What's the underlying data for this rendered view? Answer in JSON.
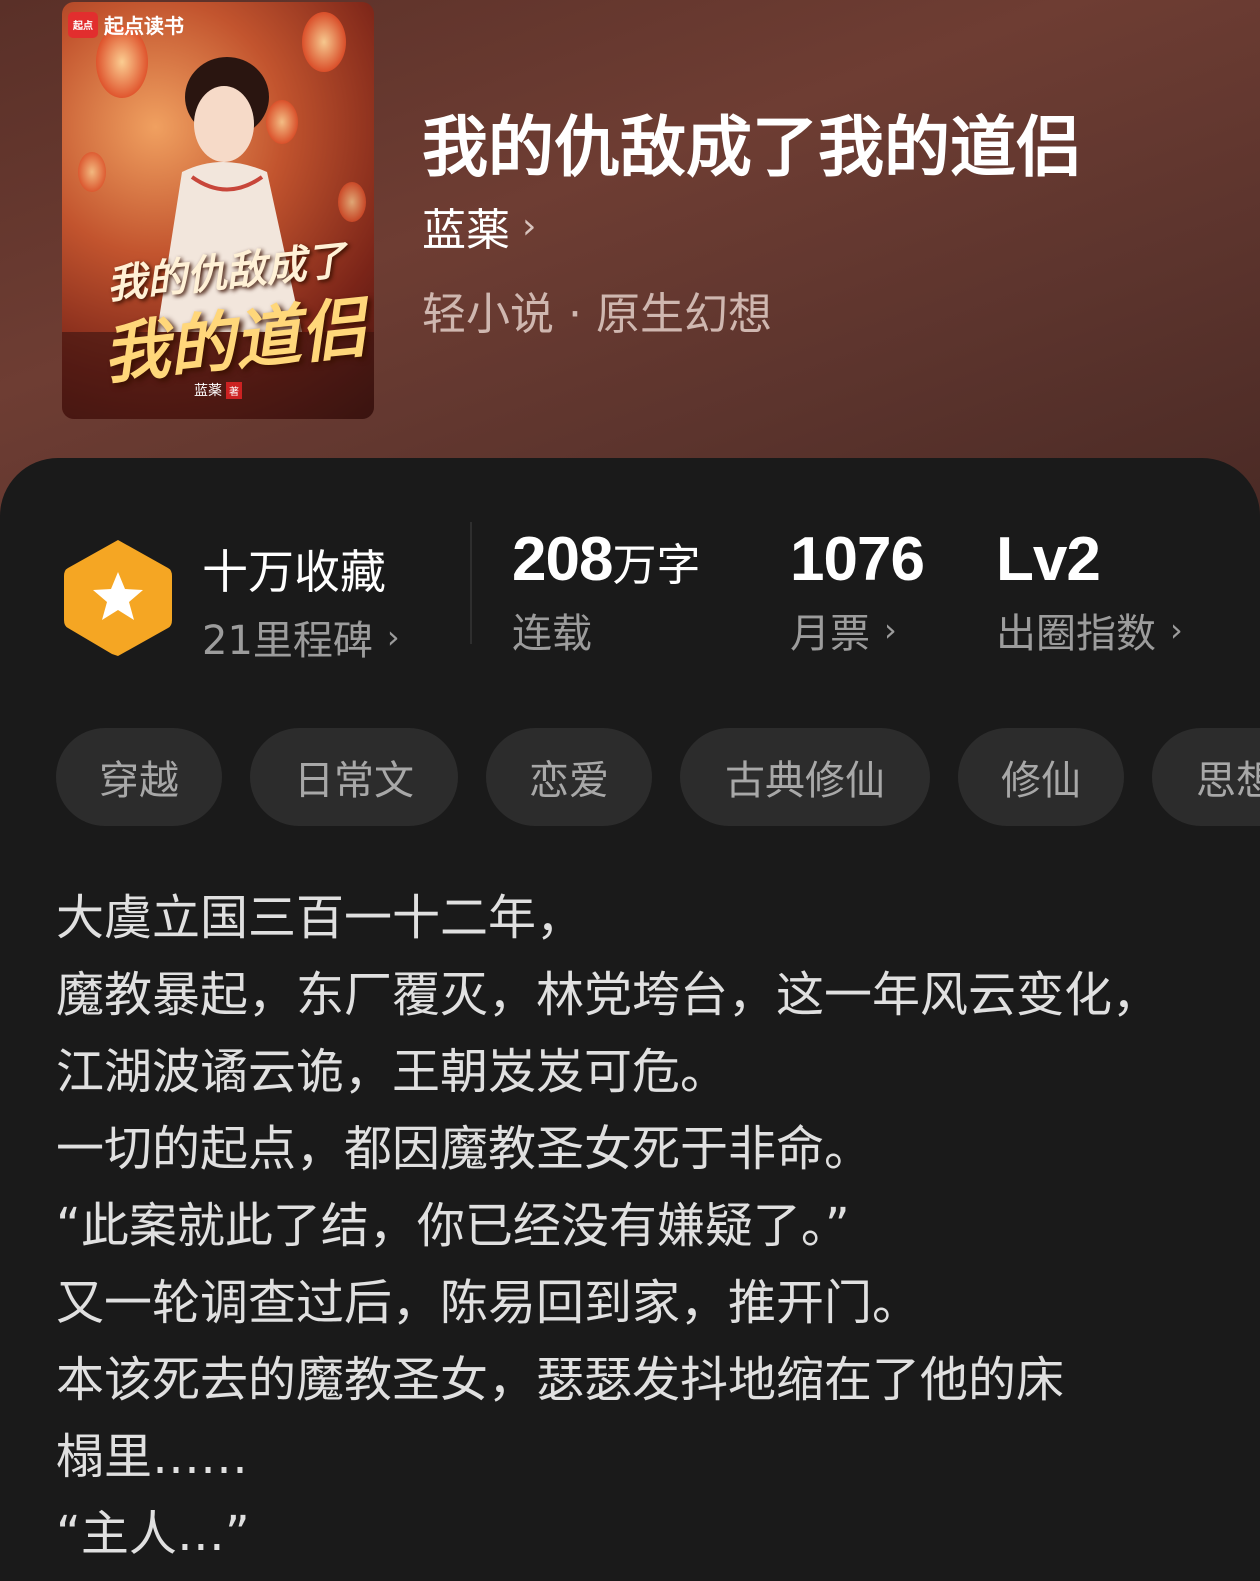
{
  "book": {
    "title": "我的仇敌成了我的道侣",
    "author": "蓝薬",
    "genre": "轻小说 · 原生幻想"
  },
  "cover": {
    "logo_mark": "起点",
    "logo_text": "起点读书",
    "title_line1": "我的仇敌成了",
    "title_line2": "我的道侣",
    "author": "蓝薬",
    "seal": "著"
  },
  "stats": {
    "badge_icon": "star-hexagon-icon",
    "collection_label": "十万收藏",
    "milestone_label": "21里程碑",
    "word_count_value": "208",
    "word_count_unit": "万字",
    "status_label": "连载",
    "monthly_votes_value": "1076",
    "monthly_votes_label": "月票",
    "level_value": "Lv2",
    "level_label": "出圈指数"
  },
  "tags": [
    "穿越",
    "日常文",
    "恋爱",
    "古典修仙",
    "修仙",
    "思想"
  ],
  "synopsis": [
    "大虞立国三百一十二年，",
    "魔教暴起，东厂覆灭，林党垮台，这一年风云变化，",
    "江湖波谲云诡，王朝岌岌可危。",
    "一切的起点，都因魔教圣女死于非命。",
    "“此案就此了结，你已经没有嫌疑了。”",
    "又一轮调查过后，陈易回到家，推开门。",
    "本该死去的魔教圣女，瑟瑟发抖地缩在了他的床",
    "榻里……",
    "“主人…”"
  ],
  "colors": {
    "header_bg": "#6e3d33",
    "panel_bg": "#1a1a1a",
    "badge": "#f5a623",
    "tag_bg": "#2c2c2c"
  }
}
